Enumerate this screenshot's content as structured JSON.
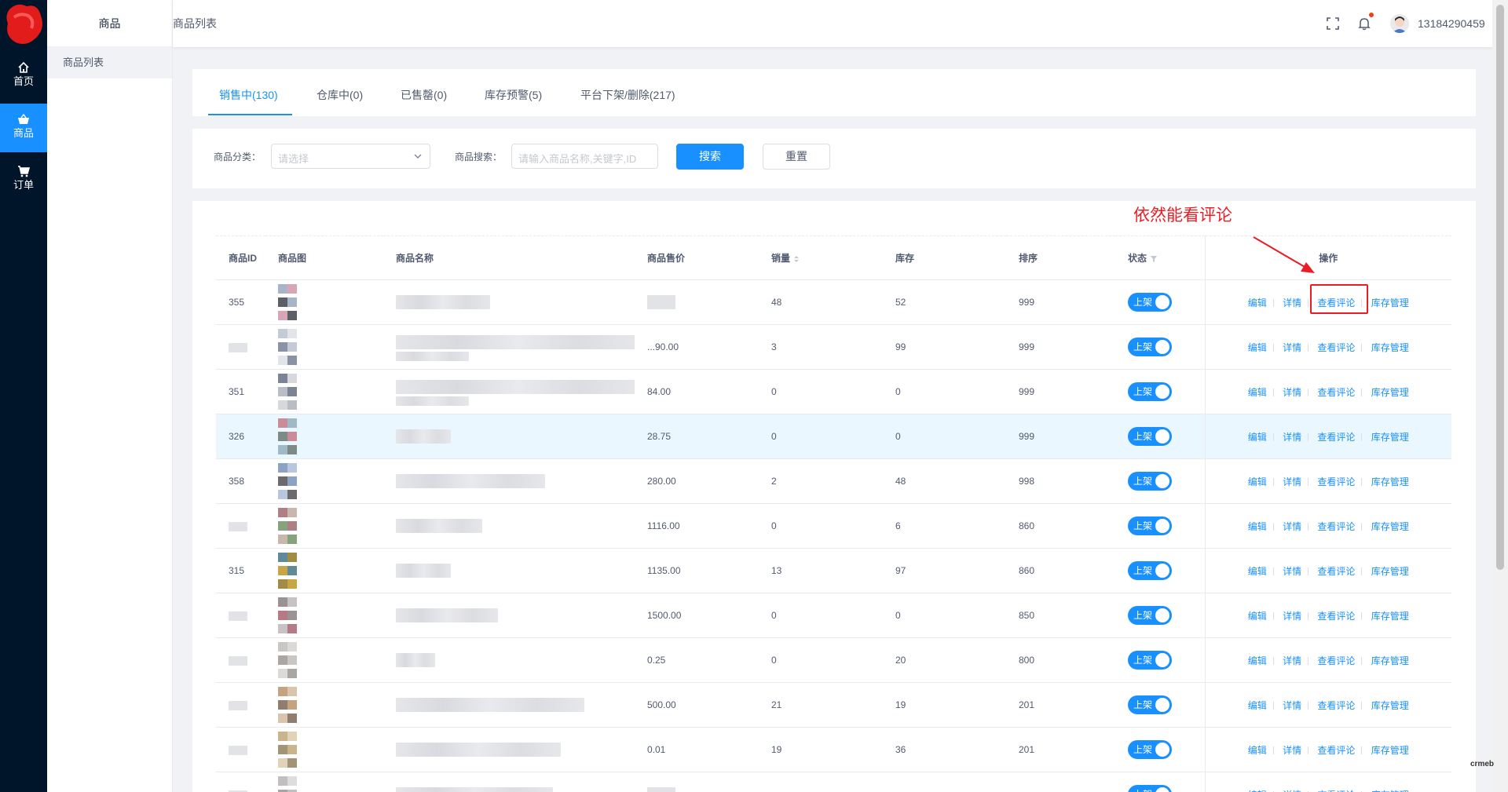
{
  "rail": {
    "items": [
      {
        "label": "首页",
        "icon": "home-icon"
      },
      {
        "label": "商品",
        "icon": "basket-icon",
        "active": true
      },
      {
        "label": "订单",
        "icon": "cart-icon"
      }
    ]
  },
  "sidebar": {
    "title": "商品",
    "items": [
      {
        "label": "商品列表",
        "active": true
      }
    ]
  },
  "header": {
    "breadcrumb": "商品列表",
    "username": "13184290459"
  },
  "tabs": [
    {
      "label": "销售中(130)",
      "active": true
    },
    {
      "label": "仓库中(0)"
    },
    {
      "label": "已售罄(0)"
    },
    {
      "label": "库存预警(5)"
    },
    {
      "label": "平台下架/删除(217)"
    }
  ],
  "filter": {
    "category_label": "商品分类：",
    "category_placeholder": "请选择",
    "search_label": "商品搜索：",
    "search_placeholder": "请输入商品名称,关键字,ID",
    "search_button": "搜索",
    "reset_button": "重置"
  },
  "annotation": {
    "text": "依然能看评论"
  },
  "table": {
    "columns": {
      "id": "商品ID",
      "image": "商品图",
      "name": "商品名称",
      "price": "商品售价",
      "sales": "销量",
      "stock": "库存",
      "sort": "排序",
      "status": "状态",
      "ops": "操作"
    },
    "status_label": "上架",
    "ops": [
      "编辑",
      "详情",
      "查看评论",
      "库存管理"
    ],
    "rows": [
      {
        "id": "355",
        "price": "",
        "sales": "48",
        "stock": "52",
        "sort": "999",
        "name_w": 120,
        "name_lines": 1,
        "palette": [
          "#a9b4c8",
          "#5c5f66",
          "#d8a6b4"
        ]
      },
      {
        "id": "",
        "price": "...90.00",
        "sales": "3",
        "stock": "99",
        "sort": "999",
        "name_w": 310,
        "name_lines": 2,
        "palette": [
          "#c4cad6",
          "#8a93a6",
          "#e2e4ea"
        ]
      },
      {
        "id": "351",
        "price": "84.00",
        "sales": "0",
        "stock": "0",
        "sort": "999",
        "name_w": 310,
        "name_lines": 2,
        "palette": [
          "#7b8396",
          "#b9bdc6",
          "#d6d8dc"
        ]
      },
      {
        "id": "326",
        "price": "28.75",
        "sales": "0",
        "stock": "0",
        "sort": "999",
        "name_w": 70,
        "name_lines": 1,
        "palette": [
          "#c98c98",
          "#7d8b86",
          "#9fb9c7"
        ],
        "hl": true
      },
      {
        "id": "358",
        "price": "280.00",
        "sales": "2",
        "stock": "48",
        "sort": "998",
        "name_w": 190,
        "name_lines": 1,
        "palette": [
          "#8da3c4",
          "#6d6a6f",
          "#b8c7de"
        ]
      },
      {
        "id": "",
        "price": "1116.00",
        "sales": "0",
        "stock": "6",
        "sort": "860",
        "name_w": 110,
        "name_lines": 1,
        "palette": [
          "#b07f86",
          "#86a37d",
          "#c8b7ad"
        ]
      },
      {
        "id": "315",
        "price": "1135.00",
        "sales": "13",
        "stock": "97",
        "sort": "860",
        "name_w": 70,
        "name_lines": 1,
        "palette": [
          "#5f8a98",
          "#c9a645",
          "#a28b44"
        ]
      },
      {
        "id": "",
        "price": "1500.00",
        "sales": "0",
        "stock": "0",
        "sort": "850",
        "name_w": 130,
        "name_lines": 1,
        "palette": [
          "#9b9393",
          "#b57a86",
          "#c7c2c4"
        ]
      },
      {
        "id": "",
        "price": "0.25",
        "sales": "0",
        "stock": "20",
        "sort": "800",
        "name_w": 50,
        "name_lines": 1,
        "palette": [
          "#c9c6c4",
          "#a9a6a4",
          "#dcdad8"
        ]
      },
      {
        "id": "",
        "price": "500.00",
        "sales": "21",
        "stock": "19",
        "sort": "201",
        "name_w": 240,
        "name_lines": 1,
        "palette": [
          "#c6a37f",
          "#8f7e70",
          "#d9c5ad"
        ]
      },
      {
        "id": "",
        "price": "0.01",
        "sales": "19",
        "stock": "36",
        "sort": "201",
        "name_w": 210,
        "name_lines": 1,
        "palette": [
          "#c9b48b",
          "#a49476",
          "#e0d3b8"
        ]
      },
      {
        "id": "",
        "price": "",
        "sales": "",
        "stock": "",
        "sort": "",
        "name_w": 200,
        "name_lines": 1,
        "palette": [
          "#c1bfbf",
          "#a9a5a5",
          "#dedcdc"
        ]
      }
    ]
  },
  "watermark": "crmeb",
  "colors": {
    "primary": "#1890ff",
    "rail_bg": "#001529",
    "annotation": "#ed1c24"
  }
}
